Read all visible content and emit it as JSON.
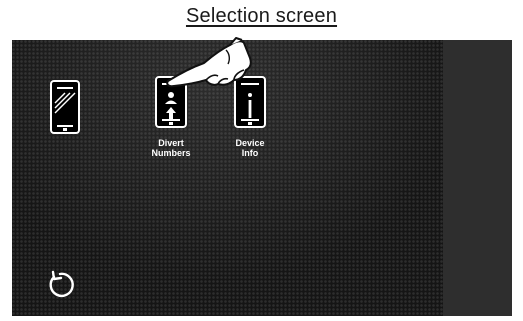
{
  "page": {
    "title": "Selection screen"
  },
  "tiles": [
    {
      "name": "phone-home",
      "label_line1": "",
      "label_line2": ""
    },
    {
      "name": "divert-numbers",
      "label_line1": "Divert",
      "label_line2": "Numbers"
    },
    {
      "name": "device-info",
      "label_line1": "Device",
      "label_line2": "Info"
    }
  ],
  "colors": {
    "screen_bg": "#151515",
    "right_panel": "#2e2e2e",
    "icon": "#ffffff"
  },
  "icons": {
    "back": "refresh-back-icon",
    "pointer": "pointing-hand-icon"
  }
}
